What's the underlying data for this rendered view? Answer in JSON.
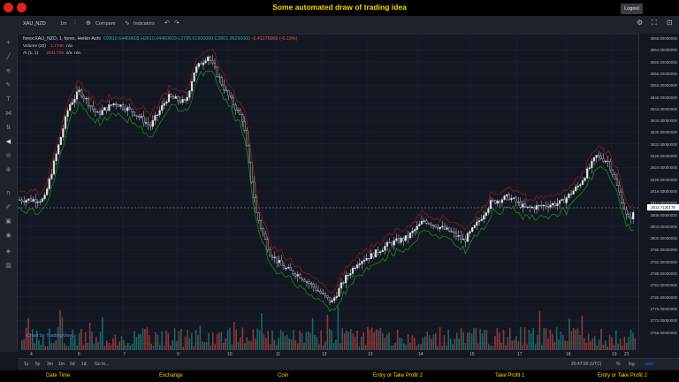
{
  "app": {
    "title": "Some automated draw of trading idea",
    "logout_label": "Logout"
  },
  "toolbar": {
    "symbol": "XAU_NZD",
    "interval": "1m",
    "compare_label": "Compare",
    "indicators_label": "Indicators"
  },
  "legend": {
    "main": "forex:XAU_NZD, 1, forex, Heikin Ashi",
    "o": "O2810.64460603",
    "h": "H2810.64460603",
    "l": "L2795.61500000",
    "c": "C2801.99250000",
    "chg": "-5.41275000 (-0.19%)",
    "volume_label": "Volume (20)",
    "volume_val": "1.174K",
    "volume_na": "n/a",
    "ai_label": "AI (1, 1)",
    "ai_val": "2811.725",
    "ai_na1": "n/a",
    "ai_na2": "n/a"
  },
  "price_axis": {
    "labels": [
      "2868.00000000",
      "2864.00000000",
      "2860.00000000",
      "2856.00000000",
      "2852.00000000",
      "2848.00000000",
      "2844.00000000",
      "2840.00000000",
      "2836.00000000",
      "2832.00000000",
      "2828.00000000",
      "2824.00000000",
      "2820.00000000",
      "2816.00000000",
      "2812.00000000",
      "2808.00000000",
      "2804.00000000",
      "2800.00000000",
      "2796.00000000",
      "2792.00000000",
      "2788.00000000",
      "2784.00000000",
      "2780.00000000",
      "2776.00000000",
      "2772.00000000",
      "2768.00000000"
    ],
    "current": "2811.7130175"
  },
  "time_axis": {
    "labels": [
      "4",
      "5",
      "7",
      "9",
      "10",
      "11",
      "12",
      "13",
      "14",
      "15",
      "17",
      "18",
      "19",
      "20",
      "21"
    ]
  },
  "bottom": {
    "ranges": [
      "1y",
      "5y",
      "3m",
      "1m",
      "5d",
      "1d",
      "Go to..."
    ],
    "clock": "20:47:50 (UTC)",
    "pct": "%",
    "log": "log",
    "auto": "auto"
  },
  "watermark": "Chart by TradingView",
  "footer": {
    "cols": [
      "Date Time",
      "Exchange",
      "Coin",
      "Entry or Take Profit 2",
      "Take Profit 1",
      "Entry or Take Profit 2"
    ]
  },
  "colors": {
    "up": "#26a69a",
    "down": "#ef5350",
    "accent_yellow": "#ffd700",
    "hi_line": "#8b1a1a",
    "lo_line": "#1b8a1b"
  }
}
